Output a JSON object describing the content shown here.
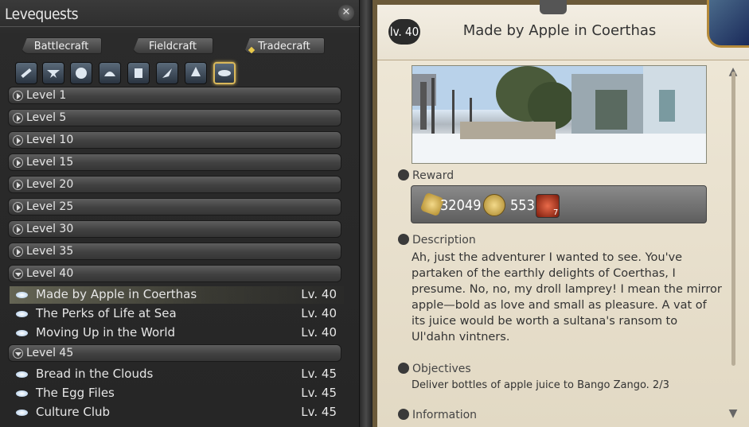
{
  "left": {
    "title": "Levequests",
    "close_icon": "close-icon",
    "tabs": [
      "Battlecraft",
      "Fieldcraft",
      "Tradecraft"
    ],
    "class_icons": [
      "carpenter-icon",
      "blacksmith-icon",
      "armorer-icon",
      "goldsmith-icon",
      "leatherworker-icon",
      "weaver-icon",
      "alchemist-icon",
      "culinarian-icon"
    ],
    "levels": [
      {
        "label": "Level 1",
        "open": false
      },
      {
        "label": "Level 5",
        "open": false
      },
      {
        "label": "Level 10",
        "open": false
      },
      {
        "label": "Level 15",
        "open": false
      },
      {
        "label": "Level 20",
        "open": false
      },
      {
        "label": "Level 25",
        "open": false
      },
      {
        "label": "Level 30",
        "open": false
      },
      {
        "label": "Level 35",
        "open": false
      },
      {
        "label": "Level 40",
        "open": true
      },
      {
        "label": "Level 45",
        "open": true
      }
    ],
    "quests40": [
      {
        "name": "Made by Apple in Coerthas",
        "lv": "Lv. 40"
      },
      {
        "name": "The Perks of Life at Sea",
        "lv": "Lv. 40"
      },
      {
        "name": "Moving Up in the World",
        "lv": "Lv. 40"
      }
    ],
    "quests45": [
      {
        "name": "Bread in the Clouds",
        "lv": "Lv. 45"
      },
      {
        "name": "The Egg Files",
        "lv": "Lv. 45"
      },
      {
        "name": "Culture Club",
        "lv": "Lv. 45"
      }
    ]
  },
  "detail": {
    "lv_badge": "lv. 40",
    "title": "Made by Apple in Coerthas",
    "reward_label": "Reward",
    "exp_value": "32049",
    "gil_value": "553",
    "crystal_qty": "7",
    "description_label": "Description",
    "description": "Ah, just the adventurer I wanted to see. You've partaken of the earthly delights of Coerthas, I presume. No, no, my droll lamprey! I mean the mirror apple—bold as love and small as pleasure. A vat of its juice would be worth a sultana's ransom to Ul'dahn vintners.",
    "objectives_label": "Objectives",
    "objective_text": "Deliver bottles of apple juice to Bango Zango. 2/3",
    "information_label": "Information"
  }
}
